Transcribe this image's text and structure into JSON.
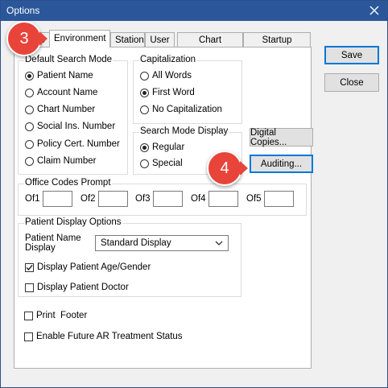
{
  "window": {
    "title": "Options"
  },
  "tabs": [
    {
      "label": "p",
      "active": false
    },
    {
      "label": "Environment",
      "active": true
    },
    {
      "label": "Station",
      "active": false
    },
    {
      "label": "User",
      "active": false
    },
    {
      "label": "Chart Settings",
      "active": false
    },
    {
      "label": "Startup Options",
      "active": false
    }
  ],
  "default_search_mode": {
    "legend": "Default Search Mode",
    "options": [
      {
        "label": "Patient Name",
        "selected": true
      },
      {
        "label": "Account Name",
        "selected": false
      },
      {
        "label": "Chart Number",
        "selected": false
      },
      {
        "label": "Social Ins. Number",
        "selected": false
      },
      {
        "label": "Policy Cert. Number",
        "selected": false
      },
      {
        "label": "Claim Number",
        "selected": false
      }
    ]
  },
  "capitalization": {
    "legend": "Capitalization",
    "options": [
      {
        "label": "All Words",
        "selected": false
      },
      {
        "label": "First Word",
        "selected": true
      },
      {
        "label": "No Capitalization",
        "selected": false
      }
    ]
  },
  "search_mode_display": {
    "legend": "Search Mode Display",
    "options": [
      {
        "label": "Regular",
        "selected": true
      },
      {
        "label": "Special",
        "selected": false
      }
    ]
  },
  "buttons": {
    "save": "Save",
    "close": "Close",
    "digital_copies": "Digital Copies...",
    "auditing": "Auditing..."
  },
  "office_codes": {
    "legend": "Office Codes Prompt",
    "fields": [
      {
        "label": "Of1",
        "value": ""
      },
      {
        "label": "Of2",
        "value": ""
      },
      {
        "label": "Of3",
        "value": ""
      },
      {
        "label": "Of4",
        "value": ""
      },
      {
        "label": "Of5",
        "value": ""
      }
    ]
  },
  "patient_display": {
    "legend": "Patient Display Options",
    "name_label_line1": "Patient Name",
    "name_label_line2": "Display",
    "name_display_value": "Standard Display",
    "age_gender": {
      "label": "Display Patient Age/Gender",
      "checked": true
    },
    "doctor": {
      "label": "Display Patient Doctor",
      "checked": false
    }
  },
  "print_footer": {
    "label": "Print  Footer",
    "checked": false
  },
  "future_ar": {
    "label": "Enable Future AR Treatment Status",
    "checked": false
  },
  "callouts": {
    "step3": "3",
    "step4": "4"
  },
  "colors": {
    "titlebar": "#2b579a",
    "callout": "#e8443a",
    "focus": "#0078d7"
  }
}
